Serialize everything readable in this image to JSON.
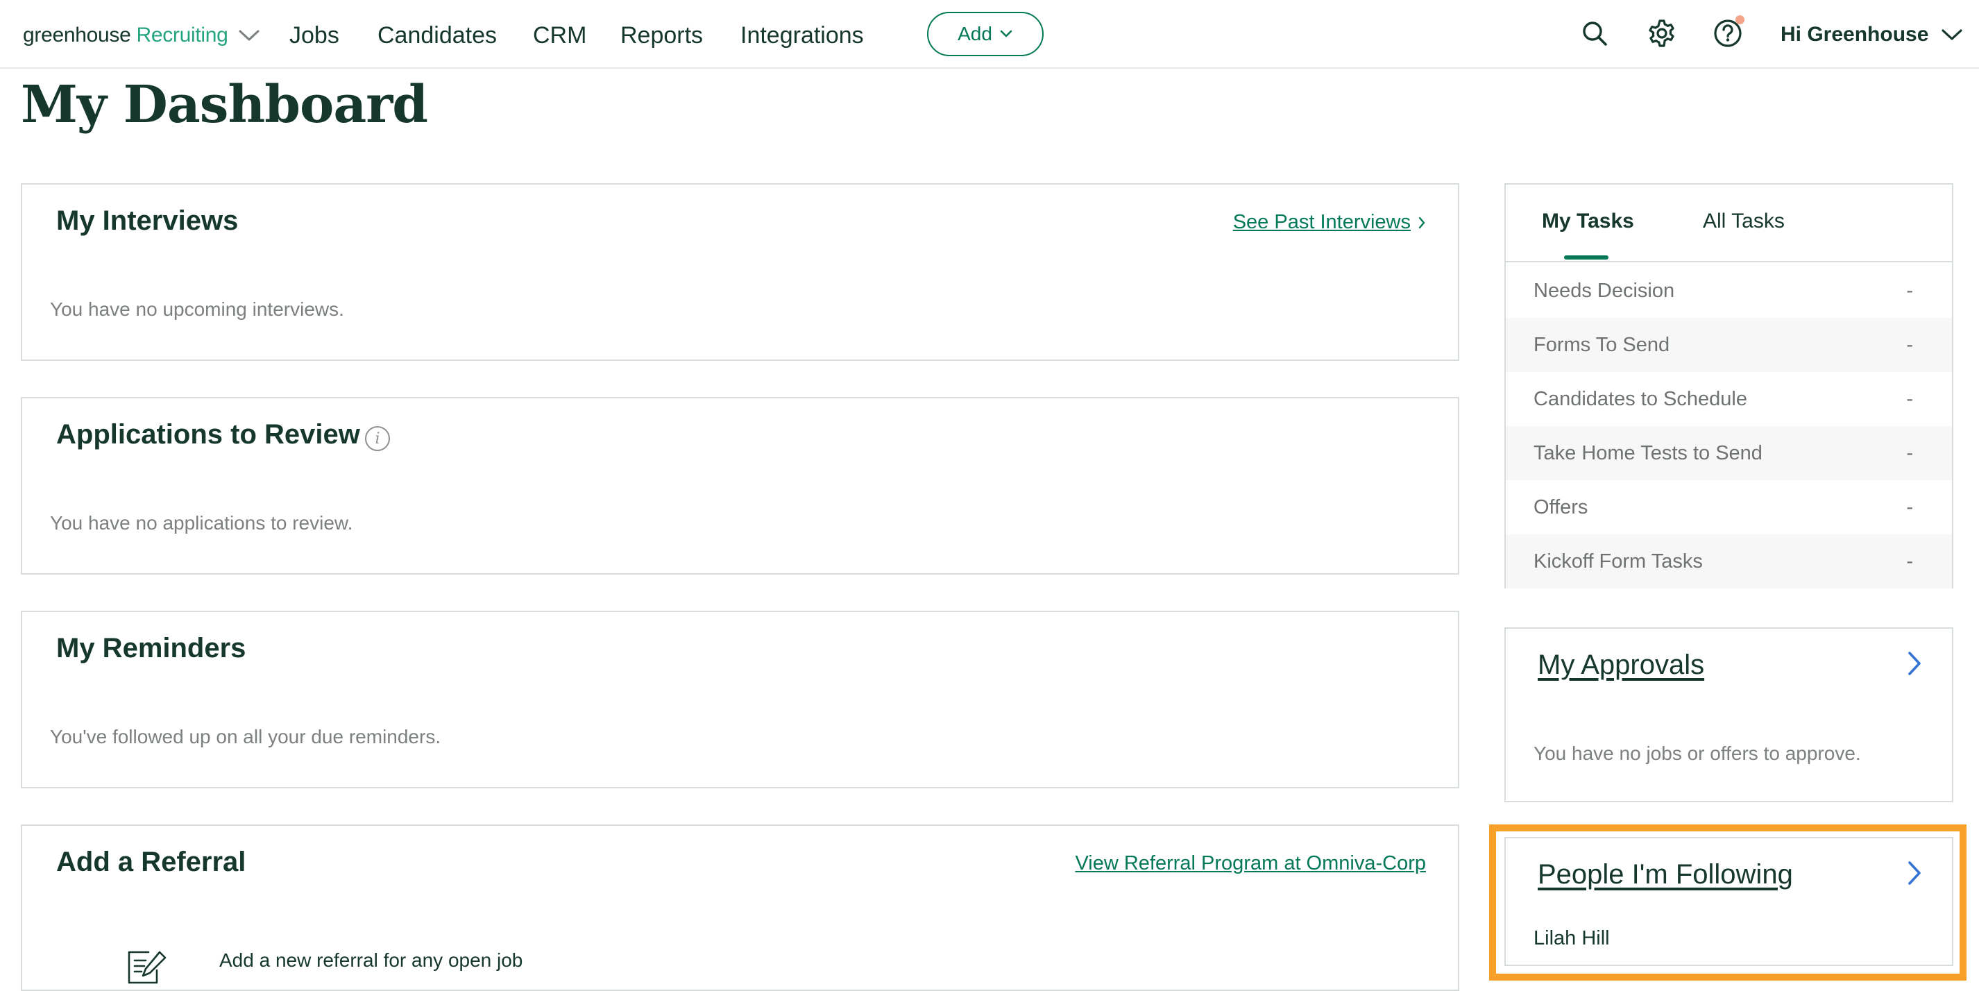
{
  "nav": {
    "brand_primary": "greenhouse",
    "brand_secondary": "Recruiting",
    "links": [
      "Jobs",
      "Candidates",
      "CRM",
      "Reports",
      "Integrations"
    ],
    "add_label": "Add",
    "user_greeting": "Hi Greenhouse",
    "icons": [
      "search-icon",
      "settings-gear-icon",
      "help-icon"
    ],
    "notification_color": "#f5a48b"
  },
  "page": {
    "title": "My Dashboard"
  },
  "cards": {
    "interviews": {
      "title": "My Interviews",
      "link": "See Past Interviews",
      "empty": "You have no upcoming interviews."
    },
    "applications": {
      "title": "Applications to Review",
      "info_glyph": "i",
      "empty": "You have no applications to review."
    },
    "reminders": {
      "title": "My Reminders",
      "empty": "You've followed up on all your due reminders."
    },
    "referral": {
      "title": "Add a Referral",
      "link": "View Referral Program at Omniva-Corp",
      "action": "Add a new referral for any open job"
    }
  },
  "tasks": {
    "tabs": [
      "My Tasks",
      "All Tasks"
    ],
    "active_tab": "My Tasks",
    "rows": [
      {
        "label": "Needs Decision",
        "count": "-"
      },
      {
        "label": "Forms To Send",
        "count": "-"
      },
      {
        "label": "Candidates to Schedule",
        "count": "-"
      },
      {
        "label": "Take Home Tests to Send",
        "count": "-"
      },
      {
        "label": "Offers",
        "count": "-"
      },
      {
        "label": "Kickoff Form Tasks",
        "count": "-"
      }
    ]
  },
  "approvals": {
    "title": "My Approvals",
    "empty": "You have no jobs or offers to approve."
  },
  "following": {
    "title": "People I'm Following",
    "people": [
      "Lilah Hill"
    ],
    "highlight_color": "#f8a12a"
  },
  "colors": {
    "brand_dark": "#15372c",
    "brand_green": "#047957",
    "brand_light_green": "#24a47f",
    "link_blue": "#3574d4"
  }
}
